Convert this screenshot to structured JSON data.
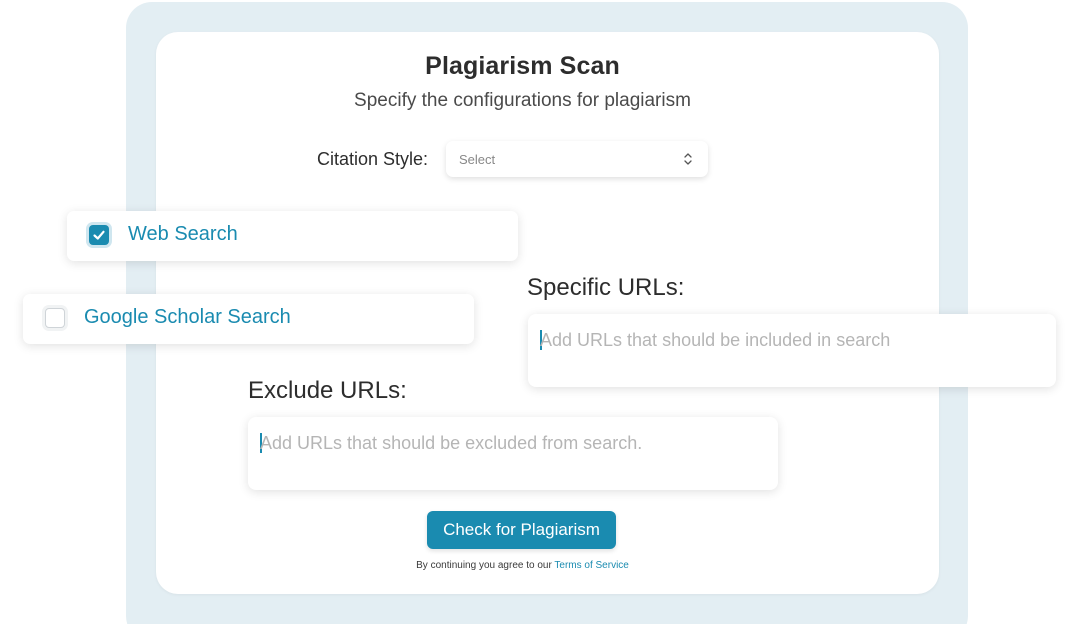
{
  "header": {
    "title": "Plagiarism Scan",
    "subtitle": "Specify the configurations for plagiarism"
  },
  "citation": {
    "label": "Citation Style:",
    "selected": "Select",
    "caret_icon": "chevron-up-down-icon"
  },
  "options": [
    {
      "label": "Web Search",
      "checked": true
    },
    {
      "label": "Google Scholar Search",
      "checked": false
    }
  ],
  "specific_urls": {
    "label": "Specific URLs:",
    "placeholder": "Add URLs that should be included in search",
    "value": ""
  },
  "exclude_urls": {
    "label": "Exclude URLs:",
    "placeholder": "Add URLs that should be excluded from search.",
    "value": ""
  },
  "submit": {
    "label": "Check for Plagiarism"
  },
  "terms": {
    "text": "By continuing you agree to our ",
    "link_label": "Terms of Service"
  },
  "colors": {
    "accent": "#1a8bb0",
    "frame": "#e3eef3",
    "text": "#2d2d2d",
    "placeholder": "#b5b5b5"
  }
}
